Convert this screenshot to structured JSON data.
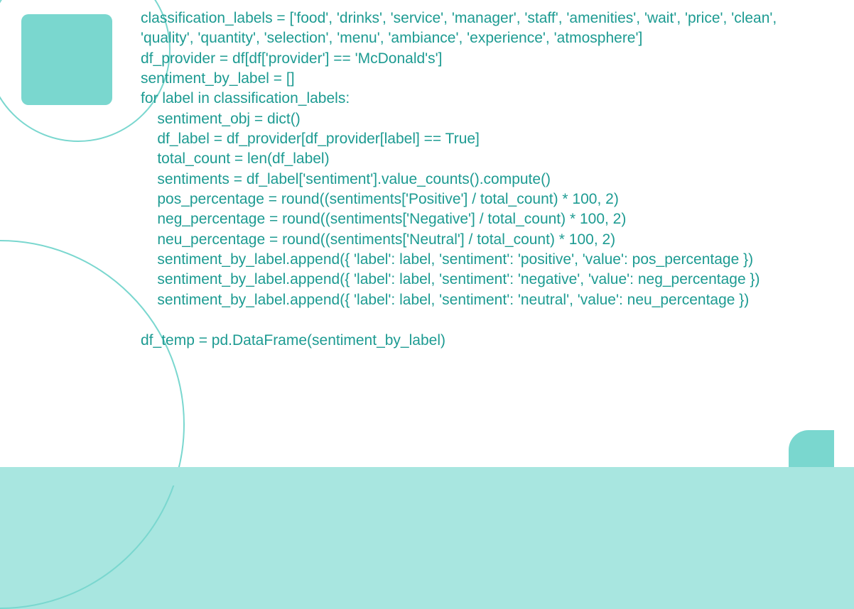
{
  "code": {
    "line1": "classification_labels = ['food', 'drinks', 'service', 'manager', 'staff', 'amenities', 'wait', 'price', 'clean', 'quality', 'quantity', 'selection', 'menu', 'ambiance', 'experience', 'atmosphere']",
    "line2": "df_provider = df[df['provider'] == 'McDonald's']",
    "line3": "sentiment_by_label = []",
    "line4": "for label in classification_labels:",
    "line5": "    sentiment_obj = dict()",
    "line6": "    df_label = df_provider[df_provider[label] == True]",
    "line7": "    total_count = len(df_label)",
    "line8": "    sentiments = df_label['sentiment'].value_counts().compute()",
    "line9": "    pos_percentage = round((sentiments['Positive'] / total_count) * 100, 2)",
    "line10": "    neg_percentage = round((sentiments['Negative'] / total_count) * 100, 2)",
    "line11": "    neu_percentage = round((sentiments['Neutral'] / total_count) * 100, 2)",
    "line12": "    sentiment_by_label.append({ 'label': label, 'sentiment': 'positive', 'value': pos_percentage })",
    "line13": "    sentiment_by_label.append({ 'label': label, 'sentiment': 'negative', 'value': neg_percentage })",
    "line14": "    sentiment_by_label.append({ 'label': label, 'sentiment': 'neutral', 'value': neu_percentage })",
    "line15": "",
    "line16": "df_temp = pd.DataFrame(sentiment_by_label)"
  }
}
